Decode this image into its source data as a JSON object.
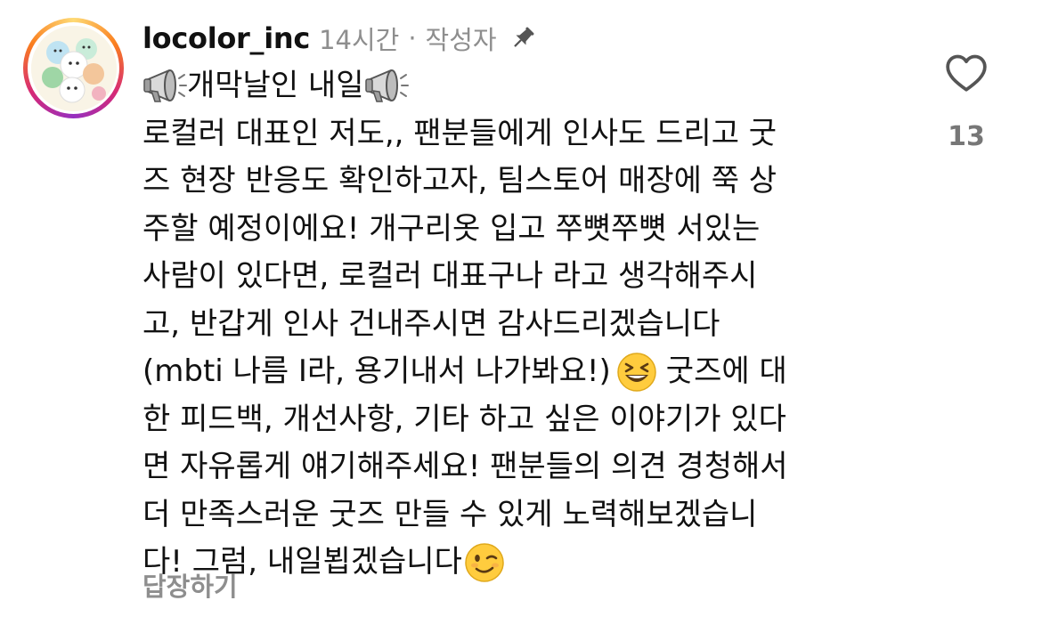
{
  "comment": {
    "username": "locolor_inc",
    "time": "14시간",
    "separator": "·",
    "author_badge": "작성자",
    "headline": "개막날인 내일",
    "lines": [
      "로컬러 대표인 저도,, 팬분들에게 인사도 드리고 굿",
      "즈 현장 반응도 확인하고자, 팀스토어 매장에 쭉 상",
      "주할 예정이에요! 개구리옷 입고 쭈뼛쭈뼛 서있는",
      "사람이 있다면, 로컬러 대표구나 라고 생각해주시",
      "고, 반갑게 인사 건내주시면 감사드리겠습니다",
      "(mbti 나름 I라, 용기내서 나가봐요!)",
      "굿즈에 대",
      "한 피드백, 개선사항, 기타 하고 싶은 이야기가 있다",
      "면 자유롭게 얘기해주세요! 팬분들의 의견 경청해서",
      "더 만족스러운 굿즈 만들 수 있게 노력해보겠습니",
      "다! 그럼, 내일뵙겠습니다"
    ],
    "reply_label": "답장하기",
    "like_count": "13"
  },
  "icons": {
    "pin": "pin-icon",
    "megaphone": "megaphone-icon",
    "laughing_emoji": "grinning-squinting-face-icon",
    "wink_emoji": "winking-face-icon",
    "heart": "heart-outline-icon"
  },
  "colors": {
    "text": "#111111",
    "meta": "#8e8e8e",
    "story_ring": [
      "#feda75",
      "#fa7e1e",
      "#d62976",
      "#962fbf"
    ]
  }
}
